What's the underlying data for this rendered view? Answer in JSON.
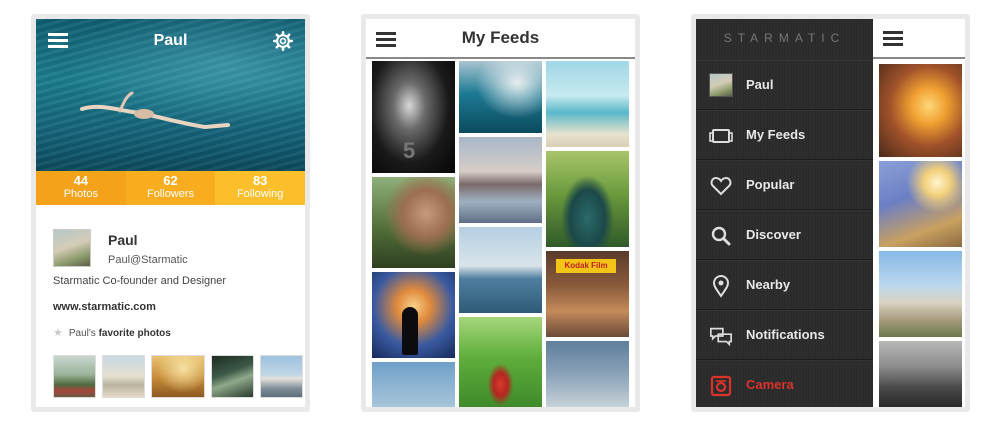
{
  "profile": {
    "header_title": "Paul",
    "stats": [
      {
        "value": "44",
        "label": "Photos"
      },
      {
        "value": "62",
        "label": "Followers"
      },
      {
        "value": "83",
        "label": "Following"
      }
    ],
    "name": "Paul",
    "handle": "Paul@Starmatic",
    "bio": "Starmatic Co-founder and Designer",
    "website": "www.starmatic.com",
    "favorites_prefix": "Paul's",
    "favorites_label": "favorite photos",
    "icons": {
      "menu": "hamburger-menu-icon",
      "settings": "gear-icon",
      "favorite": "star-icon"
    }
  },
  "feeds": {
    "header_title": "My Feeds",
    "tile_labels": {
      "airplane_tail": "5",
      "kodak_sign": "Kodak Film"
    }
  },
  "menu": {
    "brand": "STARMATIC",
    "items": [
      {
        "label": "Paul",
        "icon": "avatar"
      },
      {
        "label": "My Feeds",
        "icon": "feeds-icon"
      },
      {
        "label": "Popular",
        "icon": "heart-icon"
      },
      {
        "label": "Discover",
        "icon": "search-icon"
      },
      {
        "label": "Nearby",
        "icon": "location-pin-icon"
      },
      {
        "label": "Notifications",
        "icon": "chat-bubbles-icon"
      },
      {
        "label": "Camera",
        "icon": "camera-icon"
      }
    ],
    "active_item": "Camera",
    "colors": {
      "active": "#d9332b",
      "stat_orange": "#f7ad1d"
    }
  }
}
